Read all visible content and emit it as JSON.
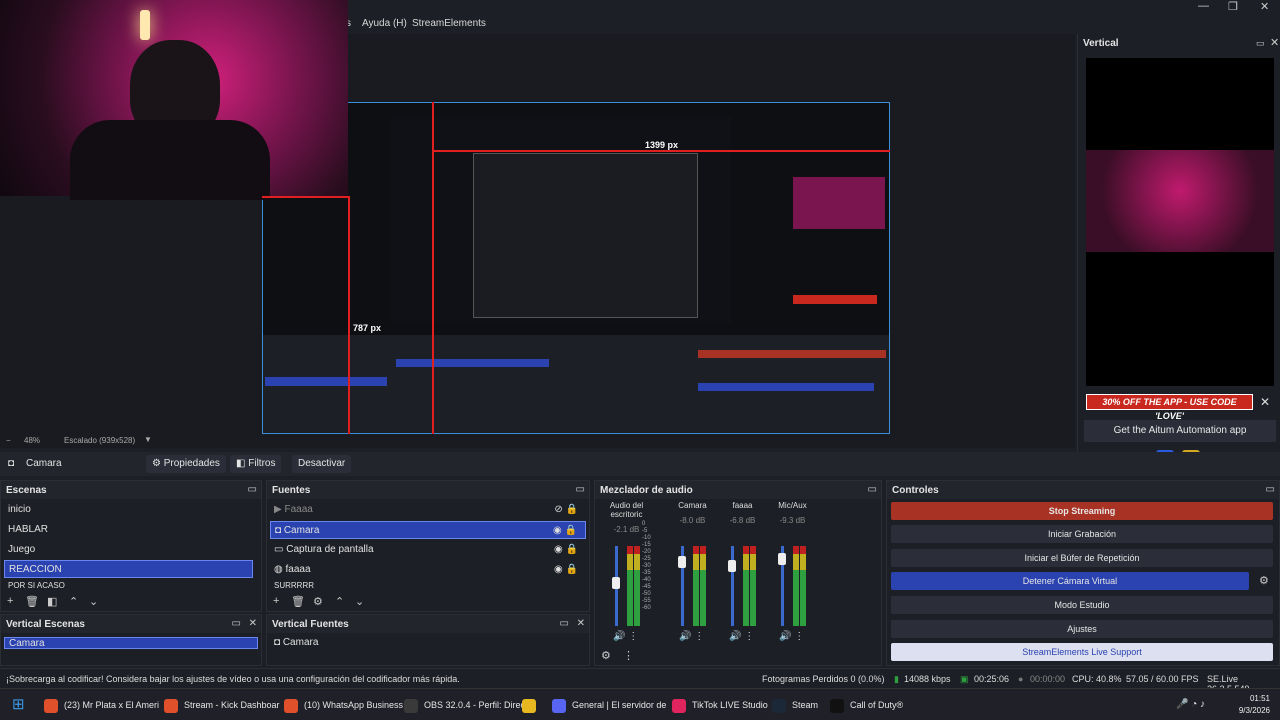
{
  "menu": {
    "items": [
      "s",
      "Ayuda (H)",
      "StreamElements"
    ]
  },
  "window_controls": [
    "—",
    "❐",
    "✕"
  ],
  "preview": {
    "measure_horizontal": "1399 px",
    "measure_vertical": "787 px",
    "zoom": "48%",
    "scaling": "Escalado (939x528)"
  },
  "vertical_panel": {
    "title": "Vertical",
    "promo": "30% OFF THE APP - USE CODE 'LOVE'",
    "get_app": "Get the Aitum Automation app"
  },
  "source_toolbar": {
    "source_name": "Camara",
    "properties": "Propiedades",
    "filters": "Filtros",
    "deactivate": "Desactivar"
  },
  "scenes": {
    "title": "Escenas",
    "items": [
      "inicio",
      "HABLAR",
      "Juego",
      "REACCION",
      "POR SI ACASO"
    ],
    "selected": "REACCION"
  },
  "sources": {
    "title": "Fuentes",
    "items": [
      "Faaaa",
      "Camara",
      "Captura de pantalla",
      "faaaa",
      "SURRRRR"
    ],
    "selected": "Camara"
  },
  "vertical_scenes": {
    "title": "Vertical Escenas",
    "items": [
      "Camara"
    ]
  },
  "vertical_sources": {
    "title": "Vertical Fuentes",
    "items": [
      "Camara"
    ]
  },
  "mixer": {
    "title": "Mezclador de audio",
    "channels": [
      {
        "name": "Audio del escritoric",
        "db": "-2.1 dB",
        "level": 0.55
      },
      {
        "name": "Camara",
        "db": "-8.0 dB",
        "level": 0.85
      },
      {
        "name": "faaaa",
        "db": "-6.8 dB",
        "level": 0.8
      },
      {
        "name": "Mic/Aux",
        "db": "-9.3 dB",
        "level": 0.9
      }
    ],
    "scale": [
      "0",
      "-5",
      "-10",
      "-15",
      "-20",
      "-25",
      "-30",
      "-35",
      "-40",
      "-45",
      "-50",
      "-55",
      "-60"
    ]
  },
  "controls": {
    "title": "Controles",
    "buttons": [
      "Stop Streaming",
      "Iniciar Grabación",
      "Iniciar el Búfer de Repetición",
      "Detener Cámara Virtual",
      "Modo Estudio",
      "Ajustes",
      "StreamElements Live Support"
    ]
  },
  "status": {
    "warning": "¡Sobrecarga al codificar! Considera bajar los ajustes de vídeo o usa una configuración del codificador más rápida.",
    "frames_lost": "Fotogramas Perdidos 0 (0.0%)",
    "bitrate": "14088 kbps",
    "stream_time": "00:25:06",
    "rec_time": "00:00:00",
    "cpu": "CPU: 40.8%",
    "fps": "57.05 / 60.00 FPS",
    "version": "SE.Live 26.2.5.549"
  },
  "taskbar": {
    "items": [
      {
        "label": "(23) Mr Plata x El Ameri",
        "color": "#e0502a"
      },
      {
        "label": "Stream - Kick Dashboar",
        "color": "#e0502a"
      },
      {
        "label": "(10) WhatsApp Business",
        "color": "#e0502a"
      },
      {
        "label": "OBS 32.0.4 - Perfil: Direc",
        "color": "#3a3a3a"
      },
      {
        "label": "",
        "color": "#e8b820"
      },
      {
        "label": "General | El servidor de",
        "color": "#5865f2"
      },
      {
        "label": "TikTok LIVE Studio",
        "color": "#e0245e"
      },
      {
        "label": "Steam",
        "color": "#1b2838"
      },
      {
        "label": "Call of Duty®",
        "color": "#111111"
      }
    ],
    "time": "01:51",
    "date": "9/3/2026"
  }
}
